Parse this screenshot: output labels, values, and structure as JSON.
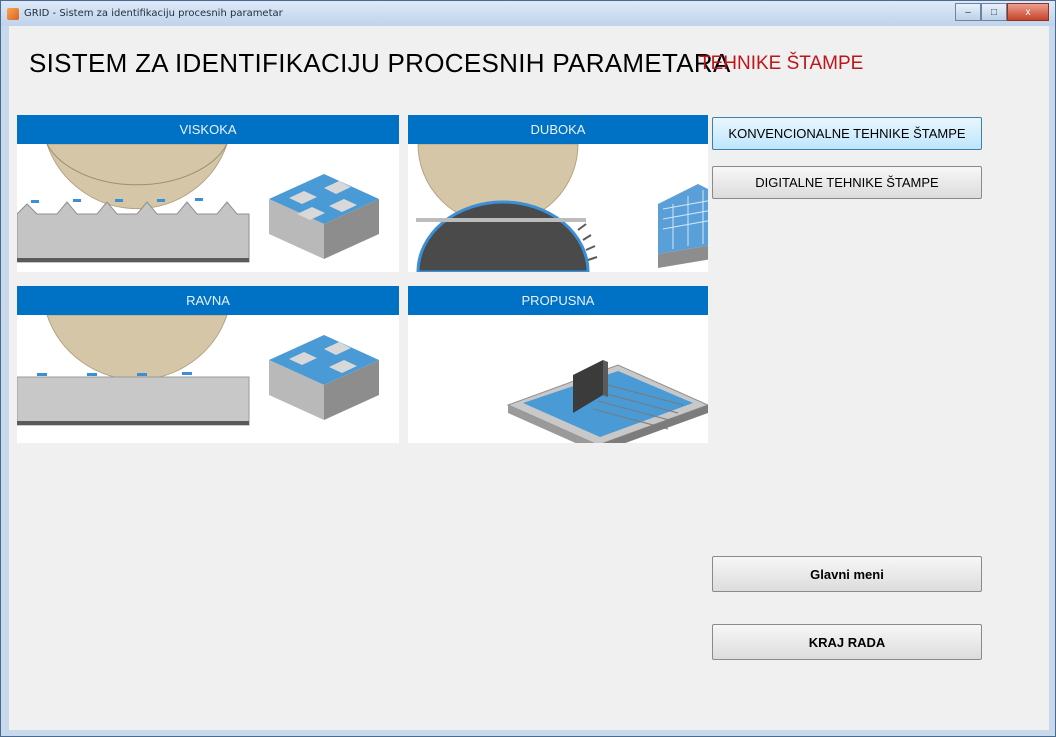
{
  "window": {
    "title": "GRID - Sistem za identifikaciju procesnih parametar",
    "controls": {
      "minimize": "–",
      "maximize": "□",
      "close": "x"
    }
  },
  "header": {
    "title": "SISTEM ZA IDENTIFIKACIJU PROCESNIH PARAMETARA",
    "subtitle": "TEHNIKE ŠTAMPE",
    "subtitle_color": "#c0141b"
  },
  "panels": {
    "viskoka": "VISKOKA",
    "duboka": "DUBOKA",
    "ravna": "RAVNA",
    "propusna": "PROPUSNA"
  },
  "buttons": {
    "konvencionalne": "KONVENCIONALNE TEHNIKE ŠTAMPE",
    "digitalne": "DIGITALNE TEHNIKE ŠTAMPE",
    "glavni_meni": "Glavni meni",
    "kraj_rada": "KRAJ RADA"
  },
  "colors": {
    "accent": "#0072c6",
    "plate_beige": "#d4c6a6",
    "substrate_gray": "#c8c8c8",
    "ink_blue": "#4a9ad6"
  }
}
